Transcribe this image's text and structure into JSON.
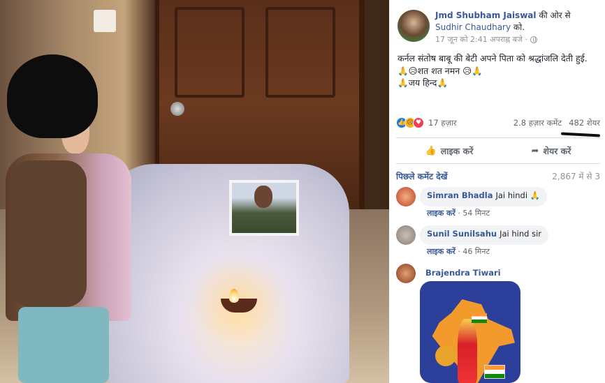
{
  "post": {
    "author_name": "Jmd Shubham Jaiswal",
    "author_suffix": " की ओर से",
    "target_name": "Sudhir Chaudhary",
    "target_suffix": " को.",
    "timestamp": "17 जून को 2:41 अपराह्न बजे ·",
    "text_line1": "कर्नल संतोष बाबू की बेटी अपने पिता को श्रद्धांजलि देती हुई.",
    "text_line2": "🙏😥शत शत नमन 😥🙏",
    "text_line3": "🙏जय हिन्द🙏"
  },
  "stats": {
    "reactions": "17 हज़ार",
    "comments": "2.8 हज़ार कमेंट",
    "shares": "482 शेयर"
  },
  "actions": {
    "like": "लाइक करें",
    "share": "शेयर करें"
  },
  "comments_header": {
    "previous": "पिछले कमेंट देखें",
    "count": "2,867 में से 3"
  },
  "comments": [
    {
      "name": "Simran Bhadla",
      "text": "Jai hindi 🙏",
      "like": "लाइक करें",
      "time": "· 54 मिनट"
    },
    {
      "name": "Sunil Sunilsahu",
      "text": "Jai hind sir",
      "like": "लाइक करें",
      "time": "· 46 मिनट"
    },
    {
      "name": "Brajendra Tiwari"
    }
  ],
  "icons": [
    "like-reaction-icon",
    "sad-reaction-icon",
    "love-reaction-icon",
    "thumbs-up-icon",
    "share-arrow-icon",
    "globe-icon"
  ],
  "colors": {
    "link": "#385898",
    "like_blue": "#1877f2"
  }
}
